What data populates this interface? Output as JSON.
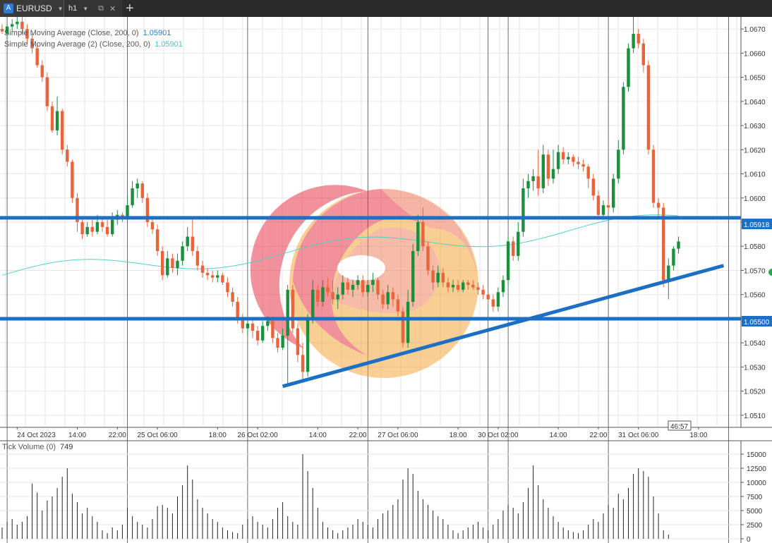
{
  "tabbar": {
    "tabs": [
      {
        "symbol_badge": "A",
        "label": "EURUSD",
        "active": true
      },
      {
        "label": "h1",
        "active": false
      }
    ],
    "new_tab_label": "+"
  },
  "indicators": [
    {
      "name": "Simple Moving Average (Close, 200, 0)",
      "value": "1.05901",
      "color": "#2a7ad6"
    },
    {
      "name": "Simple Moving Average (2) (Close, 200, 0)",
      "value": "1.05901",
      "color": "#3cc9c9"
    }
  ],
  "price_labels": {
    "upper_line": "1.05918",
    "lower_line": "1.05500",
    "countdown": "46:57"
  },
  "volume_panel": {
    "title": "Tick Volume (0)",
    "value": "749"
  },
  "colors": {
    "up_candle": "#1a8f3c",
    "down_candle": "#e8643a",
    "sr_line": "#1b6fc4",
    "sma_line": "#4fd1c5",
    "grid": "#e6e6e6"
  },
  "chart_data": [
    {
      "type": "candlestick",
      "symbol": "EURUSD",
      "timeframe": "h1",
      "ylim": [
        1.0505,
        1.0675
      ],
      "y_ticks": [
        "1.0510",
        "1.0520",
        "1.0530",
        "1.0540",
        "1.0550",
        "1.0560",
        "1.0570",
        "1.0580",
        "1.0590",
        "1.0600",
        "1.0610",
        "1.0620",
        "1.0630",
        "1.0640",
        "1.0650",
        "1.0660",
        "1.0670"
      ],
      "x_tick_labels": [
        {
          "bar": 3,
          "label": "24 Oct 2023"
        },
        {
          "bar": 15,
          "label": "14:00"
        },
        {
          "bar": 23,
          "label": "22:00"
        },
        {
          "bar": 31,
          "label": "25 Oct 06:00"
        },
        {
          "bar": 43,
          "label": "18:00"
        },
        {
          "bar": 51,
          "label": "26 Oct 02:00"
        },
        {
          "bar": 63,
          "label": "14:00"
        },
        {
          "bar": 71,
          "label": "22:00"
        },
        {
          "bar": 79,
          "label": "27 Oct 06:00"
        },
        {
          "bar": 91,
          "label": "18:00"
        },
        {
          "bar": 99,
          "label": "30 Oct 02:00"
        },
        {
          "bar": 111,
          "label": "14:00"
        },
        {
          "bar": 119,
          "label": "22:00"
        },
        {
          "bar": 127,
          "label": "31 Oct 06:00"
        },
        {
          "bar": 139,
          "label": "18:00"
        }
      ],
      "candles": [
        [
          1.067,
          1.0672,
          1.0668,
          1.0669
        ],
        [
          1.0668,
          1.0672,
          1.0665,
          1.0671
        ],
        [
          1.0671,
          1.0674,
          1.0669,
          1.0672
        ],
        [
          1.0672,
          1.0675,
          1.067,
          1.0673
        ],
        [
          1.0673,
          1.0675,
          1.0668,
          1.067
        ],
        [
          1.067,
          1.0672,
          1.0664,
          1.0666
        ],
        [
          1.0666,
          1.0668,
          1.066,
          1.0662
        ],
        [
          1.0662,
          1.0664,
          1.0654,
          1.0655
        ],
        [
          1.0655,
          1.0657,
          1.0648,
          1.065
        ],
        [
          1.065,
          1.0652,
          1.0636,
          1.0638
        ],
        [
          1.0638,
          1.064,
          1.0627,
          1.0628
        ],
        [
          1.0628,
          1.0642,
          1.0626,
          1.0636
        ],
        [
          1.0636,
          1.0637,
          1.0618,
          1.062
        ],
        [
          1.062,
          1.0622,
          1.0613,
          1.0615
        ],
        [
          1.0615,
          1.0616,
          1.0598,
          1.06
        ],
        [
          1.06,
          1.0602,
          1.0586,
          1.059
        ],
        [
          1.059,
          1.0592,
          1.0583,
          1.0585
        ],
        [
          1.0585,
          1.059,
          1.0584,
          1.0588
        ],
        [
          1.0588,
          1.0592,
          1.0584,
          1.0586
        ],
        [
          1.0586,
          1.0593,
          1.0585,
          1.059
        ],
        [
          1.059,
          1.0592,
          1.0586,
          1.0588
        ],
        [
          1.0588,
          1.0591,
          1.0584,
          1.0585
        ],
        [
          1.0585,
          1.0594,
          1.0584,
          1.0591
        ],
        [
          1.0591,
          1.0595,
          1.0589,
          1.0593
        ],
        [
          1.0593,
          1.0594,
          1.059,
          1.0592
        ],
        [
          1.0592,
          1.0601,
          1.0591,
          1.0597
        ],
        [
          1.0597,
          1.0607,
          1.0596,
          1.0604
        ],
        [
          1.0604,
          1.0608,
          1.06,
          1.0606
        ],
        [
          1.0606,
          1.0607,
          1.0598,
          1.06
        ],
        [
          1.06,
          1.0602,
          1.0588,
          1.059
        ],
        [
          1.059,
          1.0592,
          1.0585,
          1.0587
        ],
        [
          1.0587,
          1.0589,
          1.0576,
          1.0578
        ],
        [
          1.0578,
          1.058,
          1.0566,
          1.0568
        ],
        [
          1.0568,
          1.0578,
          1.0567,
          1.0575
        ],
        [
          1.0575,
          1.0577,
          1.0569,
          1.0571
        ],
        [
          1.0571,
          1.0577,
          1.0568,
          1.0574
        ],
        [
          1.0574,
          1.0582,
          1.0572,
          1.058
        ],
        [
          1.058,
          1.0588,
          1.0578,
          1.0584
        ],
        [
          1.0584,
          1.0592,
          1.0576,
          1.0578
        ],
        [
          1.0578,
          1.058,
          1.057,
          1.0572
        ],
        [
          1.0572,
          1.0574,
          1.0567,
          1.0569
        ],
        [
          1.0569,
          1.0571,
          1.0566,
          1.0568
        ],
        [
          1.0568,
          1.057,
          1.0565,
          1.0567
        ],
        [
          1.0567,
          1.057,
          1.0565,
          1.0568
        ],
        [
          1.0568,
          1.0569,
          1.0564,
          1.0565
        ],
        [
          1.0565,
          1.0567,
          1.0559,
          1.0561
        ],
        [
          1.0561,
          1.0563,
          1.0555,
          1.0557
        ],
        [
          1.0557,
          1.0559,
          1.0548,
          1.055
        ],
        [
          1.055,
          1.0552,
          1.0544,
          1.0546
        ],
        [
          1.0546,
          1.055,
          1.0543,
          1.0548
        ],
        [
          1.0548,
          1.055,
          1.0542,
          1.0545
        ],
        [
          1.0545,
          1.0547,
          1.0539,
          1.0541
        ],
        [
          1.0541,
          1.0549,
          1.054,
          1.0547
        ],
        [
          1.0547,
          1.0551,
          1.0545,
          1.0549
        ],
        [
          1.0549,
          1.0551,
          1.054,
          1.0542
        ],
        [
          1.0542,
          1.0544,
          1.0536,
          1.0538
        ],
        [
          1.0538,
          1.0546,
          1.0537,
          1.0543
        ],
        [
          1.0543,
          1.0564,
          1.0522,
          1.0562
        ],
        [
          1.0562,
          1.0564,
          1.0544,
          1.0546
        ],
        [
          1.0546,
          1.0548,
          1.0532,
          1.0535
        ],
        [
          1.0535,
          1.054,
          1.0524,
          1.0528
        ],
        [
          1.0528,
          1.0552,
          1.0526,
          1.055
        ],
        [
          1.055,
          1.0566,
          1.0548,
          1.0562
        ],
        [
          1.0562,
          1.0564,
          1.0555,
          1.0557
        ],
        [
          1.0557,
          1.0566,
          1.0555,
          1.0563
        ],
        [
          1.0563,
          1.0567,
          1.0559,
          1.0561
        ],
        [
          1.0561,
          1.0566,
          1.0556,
          1.0558
        ],
        [
          1.0558,
          1.0563,
          1.0554,
          1.056
        ],
        [
          1.056,
          1.0568,
          1.0558,
          1.0565
        ],
        [
          1.0565,
          1.0567,
          1.056,
          1.0562
        ],
        [
          1.0562,
          1.0566,
          1.0559,
          1.0564
        ],
        [
          1.0564,
          1.0568,
          1.0562,
          1.0566
        ],
        [
          1.0566,
          1.0568,
          1.0559,
          1.0561
        ],
        [
          1.0561,
          1.0566,
          1.0559,
          1.0564
        ],
        [
          1.0564,
          1.0569,
          1.0561,
          1.0566
        ],
        [
          1.0566,
          1.0567,
          1.0558,
          1.056
        ],
        [
          1.056,
          1.0562,
          1.0554,
          1.0556
        ],
        [
          1.0556,
          1.0564,
          1.0554,
          1.0561
        ],
        [
          1.0561,
          1.0563,
          1.0555,
          1.0558
        ],
        [
          1.0558,
          1.056,
          1.0551,
          1.0553
        ],
        [
          1.0553,
          1.0555,
          1.0538,
          1.054
        ],
        [
          1.054,
          1.0562,
          1.0538,
          1.0557
        ],
        [
          1.0557,
          1.0581,
          1.0555,
          1.0578
        ],
        [
          1.0578,
          1.0593,
          1.0576,
          1.059
        ],
        [
          1.059,
          1.0596,
          1.0578,
          1.058
        ],
        [
          1.058,
          1.0582,
          1.0568,
          1.057
        ],
        [
          1.057,
          1.0572,
          1.0562,
          1.0565
        ],
        [
          1.0565,
          1.0572,
          1.0563,
          1.0569
        ],
        [
          1.0569,
          1.0571,
          1.0563,
          1.0565
        ],
        [
          1.0565,
          1.0567,
          1.0561,
          1.0563
        ],
        [
          1.0563,
          1.0566,
          1.0561,
          1.0564
        ],
        [
          1.0564,
          1.0566,
          1.0561,
          1.0562
        ],
        [
          1.0562,
          1.0566,
          1.0561,
          1.0565
        ],
        [
          1.0565,
          1.0566,
          1.0562,
          1.0564
        ],
        [
          1.0564,
          1.0566,
          1.0562,
          1.0563
        ],
        [
          1.0563,
          1.0565,
          1.056,
          1.0562
        ],
        [
          1.0562,
          1.0564,
          1.0558,
          1.056
        ],
        [
          1.056,
          1.0562,
          1.0556,
          1.0558
        ],
        [
          1.0558,
          1.056,
          1.0553,
          1.0555
        ],
        [
          1.0555,
          1.0563,
          1.0553,
          1.0561
        ],
        [
          1.0561,
          1.0568,
          1.0559,
          1.0566
        ],
        [
          1.0566,
          1.0584,
          1.0564,
          1.0582
        ],
        [
          1.0582,
          1.0584,
          1.0574,
          1.0576
        ],
        [
          1.0576,
          1.059,
          1.0574,
          1.0586
        ],
        [
          1.0586,
          1.0608,
          1.0584,
          1.0604
        ],
        [
          1.0604,
          1.061,
          1.06,
          1.0607
        ],
        [
          1.0607,
          1.0612,
          1.0603,
          1.0609
        ],
        [
          1.0609,
          1.062,
          1.0601,
          1.0604
        ],
        [
          1.0604,
          1.0622,
          1.0602,
          1.0618
        ],
        [
          1.0618,
          1.062,
          1.0605,
          1.0608
        ],
        [
          1.0608,
          1.062,
          1.0606,
          1.0612
        ],
        [
          1.0612,
          1.0622,
          1.061,
          1.0619
        ],
        [
          1.0619,
          1.0621,
          1.0614,
          1.0616
        ],
        [
          1.0616,
          1.0619,
          1.0614,
          1.0617
        ],
        [
          1.0617,
          1.0618,
          1.0613,
          1.0615
        ],
        [
          1.0615,
          1.0617,
          1.0612,
          1.0614
        ],
        [
          1.0614,
          1.0616,
          1.0611,
          1.0613
        ],
        [
          1.0613,
          1.0614,
          1.0604,
          1.0608
        ],
        [
          1.0608,
          1.061,
          1.0599,
          1.0601
        ],
        [
          1.0601,
          1.0603,
          1.0591,
          1.0593
        ],
        [
          1.0593,
          1.0599,
          1.0591,
          1.0597
        ],
        [
          1.0597,
          1.06,
          1.0594,
          1.0596
        ],
        [
          1.0596,
          1.061,
          1.0594,
          1.0608
        ],
        [
          1.0608,
          1.0624,
          1.0606,
          1.062
        ],
        [
          1.062,
          1.0648,
          1.0618,
          1.0646
        ],
        [
          1.0646,
          1.0664,
          1.0644,
          1.0662
        ],
        [
          1.0662,
          1.0675,
          1.066,
          1.0668
        ],
        [
          1.0668,
          1.067,
          1.0662,
          1.0664
        ],
        [
          1.0664,
          1.0666,
          1.0652,
          1.0655
        ],
        [
          1.0655,
          1.0657,
          1.0618,
          1.062
        ],
        [
          1.062,
          1.0622,
          1.0596,
          1.0598
        ],
        [
          1.0598,
          1.06,
          1.0592,
          1.0596
        ],
        [
          1.0596,
          1.0598,
          1.0563,
          1.0566
        ],
        [
          1.0566,
          1.0575,
          1.0558,
          1.0572
        ],
        [
          1.0572,
          1.058,
          1.057,
          1.0579
        ],
        [
          1.0579,
          1.0584,
          1.0577,
          1.0582
        ]
      ],
      "volume": {
        "ylim": [
          0,
          16000
        ],
        "y_ticks": [
          "0",
          "2500",
          "5000",
          "7500",
          "10000",
          "12500",
          "15000"
        ],
        "values": [
          2000,
          3000,
          3500,
          2500,
          3000,
          4000,
          9800,
          8200,
          5000,
          6800,
          7500,
          9000,
          11000,
          12500,
          8000,
          6500,
          4500,
          5500,
          4000,
          3000,
          1500,
          1000,
          2000,
          1500,
          2500,
          5500,
          4000,
          3000,
          2500,
          2000,
          3500,
          5800,
          6000,
          5500,
          4500,
          7500,
          9500,
          13000,
          10500,
          7000,
          5500,
          4500,
          3500,
          3000,
          2000,
          1500,
          1200,
          1000,
          2500,
          3500,
          4000,
          3000,
          2500,
          2000,
          3500,
          5500,
          6500,
          4000,
          3000,
          2500,
          15000,
          12000,
          9000,
          5500,
          3000,
          2000,
          1500,
          1000,
          1500,
          2000,
          2500,
          3500,
          3000,
          2500,
          2000,
          3500,
          4500,
          5000,
          6000,
          7000,
          10500,
          12500,
          11500,
          8500,
          7000,
          6000,
          5000,
          4000,
          3500,
          2500,
          1500,
          1000,
          1500,
          2000,
          2500,
          3000,
          2000,
          1500,
          2500,
          3500,
          5000,
          6000,
          5500,
          4500,
          6500,
          9000,
          13000,
          9500,
          7000,
          5500,
          4000,
          3000,
          2000,
          1500,
          1200,
          1000,
          1500,
          2500,
          3500,
          3000,
          4500,
          6000,
          5500,
          8000,
          7000,
          9000,
          11500,
          12500,
          12000,
          11000,
          7500,
          4500,
          1500,
          749
        ]
      },
      "support_resistance": [
        1.05918,
        1.055
      ],
      "trendline": {
        "from": {
          "bar": 56,
          "price": 1.0522
        },
        "to": {
          "bar": 144,
          "price": 1.0572
        }
      },
      "moving_averages": [
        {
          "name": "Simple Moving Average (Close, 200, 0)",
          "value": 1.05901
        }
      ]
    }
  ]
}
